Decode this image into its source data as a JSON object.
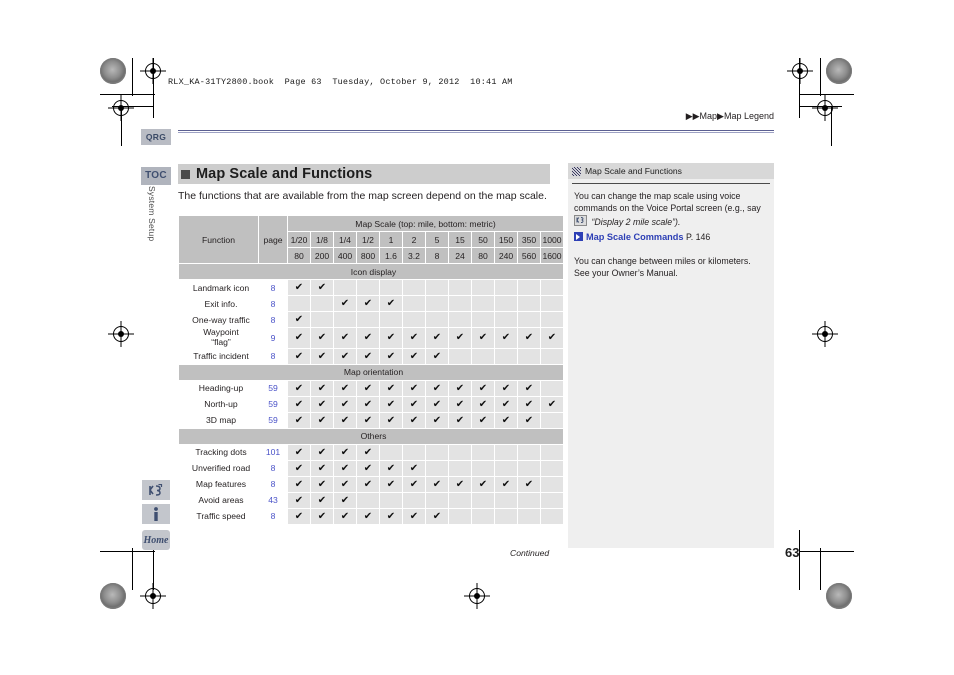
{
  "runninghead": {
    "bookline": "RLX_KA-31TY2800.book  Page 63  Tuesday, October 9, 2012  10:41 AM",
    "breadcrumb": "▶▶Map▶Map Legend"
  },
  "sidebar": {
    "tabs": [
      {
        "name": "qrg",
        "label": "QRG"
      },
      {
        "name": "toc",
        "label": "TOC"
      }
    ],
    "vertical_label": "System Setup",
    "icons": [
      {
        "name": "voice-command-icon",
        "label": ""
      },
      {
        "name": "info-icon",
        "label": ""
      },
      {
        "name": "home-icon",
        "label": "Home"
      }
    ]
  },
  "main": {
    "heading": "Map Scale and Functions",
    "intro": "The functions that are available from the map screen depend on the map scale.",
    "table": {
      "col_function": "Function",
      "col_page": "page",
      "scale_title": "Map Scale (top: mile, bottom: metric)",
      "scale_mile": [
        "1/20",
        "1/8",
        "1/4",
        "1/2",
        "1",
        "2",
        "5",
        "15",
        "50",
        "150",
        "350",
        "1000"
      ],
      "scale_metric": [
        "80",
        "200",
        "400",
        "800",
        "1.6",
        "3.2",
        "8",
        "24",
        "80",
        "240",
        "560",
        "1600"
      ],
      "check_glyph": "✔",
      "sections": [
        {
          "title": "Icon display",
          "rows": [
            {
              "function": "Landmark icon",
              "page": "8",
              "checks": [
                1,
                1,
                0,
                0,
                0,
                0,
                0,
                0,
                0,
                0,
                0,
                0
              ]
            },
            {
              "function": "Exit info.",
              "page": "8",
              "checks": [
                0,
                0,
                1,
                1,
                1,
                0,
                0,
                0,
                0,
                0,
                0,
                0
              ]
            },
            {
              "function": "One-way traffic",
              "page": "8",
              "checks": [
                1,
                0,
                0,
                0,
                0,
                0,
                0,
                0,
                0,
                0,
                0,
                0
              ]
            },
            {
              "function": "Waypoint\n“flag”",
              "page": "9",
              "checks": [
                1,
                1,
                1,
                1,
                1,
                1,
                1,
                1,
                1,
                1,
                1,
                1
              ],
              "tall": true
            },
            {
              "function": "Traffic incident",
              "page": "8",
              "checks": [
                1,
                1,
                1,
                1,
                1,
                1,
                1,
                0,
                0,
                0,
                0,
                0
              ]
            }
          ]
        },
        {
          "title": "Map orientation",
          "rows": [
            {
              "function": "Heading-up",
              "page": "59",
              "checks": [
                1,
                1,
                1,
                1,
                1,
                1,
                1,
                1,
                1,
                1,
                1,
                0
              ]
            },
            {
              "function": "North-up",
              "page": "59",
              "checks": [
                1,
                1,
                1,
                1,
                1,
                1,
                1,
                1,
                1,
                1,
                1,
                1
              ]
            },
            {
              "function": "3D map",
              "page": "59",
              "checks": [
                1,
                1,
                1,
                1,
                1,
                1,
                1,
                1,
                1,
                1,
                1,
                0
              ]
            }
          ]
        },
        {
          "title": "Others",
          "rows": [
            {
              "function": "Tracking dots",
              "page": "101",
              "checks": [
                1,
                1,
                1,
                1,
                0,
                0,
                0,
                0,
                0,
                0,
                0,
                0
              ]
            },
            {
              "function": "Unverified road",
              "page": "8",
              "checks": [
                1,
                1,
                1,
                1,
                1,
                1,
                0,
                0,
                0,
                0,
                0,
                0
              ]
            },
            {
              "function": "Map features",
              "page": "8",
              "checks": [
                1,
                1,
                1,
                1,
                1,
                1,
                1,
                1,
                1,
                1,
                1,
                0
              ]
            },
            {
              "function": "Avoid areas",
              "page": "43",
              "checks": [
                1,
                1,
                1,
                0,
                0,
                0,
                0,
                0,
                0,
                0,
                0,
                0
              ]
            },
            {
              "function": "Traffic speed",
              "page": "8",
              "checks": [
                1,
                1,
                1,
                1,
                1,
                1,
                1,
                0,
                0,
                0,
                0,
                0
              ]
            }
          ]
        }
      ]
    }
  },
  "panel": {
    "title": "Map Scale and Functions",
    "para1_a": "You can change the map scale using voice commands on the Voice Portal screen (e.g., say",
    "para1_quote": "“Display 2 mile scale”).",
    "link_label": "Map Scale Commands",
    "link_page": "P. 146",
    "para2": "You can change between miles or kilometers. See your Owner’s Manual."
  },
  "footer": {
    "continued": "Continued",
    "page_number": "63"
  },
  "colors": {
    "link_blue": "#2d3fb5",
    "page_ref_blue": "#4a52c8",
    "header_grey": "#c0c0c0",
    "cell_grey": "#e3e3e3",
    "panel_bg": "#efefef",
    "rule_blue": "#5b5f91"
  }
}
